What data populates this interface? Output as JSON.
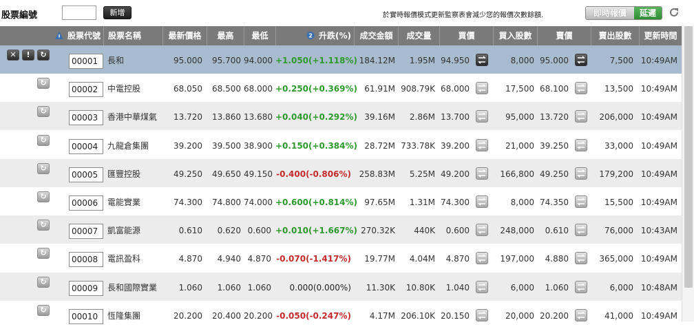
{
  "toolbar": {
    "label": "股票編號",
    "input_value": "",
    "add_label": "新增",
    "notice": "於實時報價模式更新監察表會減少您的報價次數餘額.",
    "mode_realtime": "即時報價",
    "mode_delayed": "延遲"
  },
  "columns": [
    "股票代號",
    "股票名稱",
    "最新價格",
    "最高",
    "最低",
    "升跌(%)",
    "成交金額",
    "成交量",
    "買價",
    "買入股數",
    "賣價",
    "賣出股數",
    "更新時間"
  ],
  "colors": {
    "up": "#2e9a2e",
    "down": "#c42b2b",
    "header": "#7a7a7a",
    "selected": "#a9bccf"
  },
  "rows": [
    {
      "code": "00001",
      "name": "長和",
      "last": "95.000",
      "high": "95.700",
      "low": "94.000",
      "change": "+1.050(+1.118%)",
      "dir": "up",
      "turnover": "184.12M",
      "volume": "1.95M",
      "bid": "94.950",
      "bid_qty": "8,000",
      "ask": "95.000",
      "ask_qty": "7,500",
      "time": "10:49AM"
    },
    {
      "code": "00002",
      "name": "中電控股",
      "last": "68.050",
      "high": "68.500",
      "low": "68.000",
      "change": "+0.250(+0.369%)",
      "dir": "up",
      "turnover": "61.91M",
      "volume": "908.79K",
      "bid": "68.000",
      "bid_qty": "17,500",
      "ask": "68.100",
      "ask_qty": "13,500",
      "time": "10:49AM"
    },
    {
      "code": "00003",
      "name": "香港中華煤氣",
      "last": "13.720",
      "high": "13.860",
      "low": "13.680",
      "change": "+0.040(+0.292%)",
      "dir": "up",
      "turnover": "39.16M",
      "volume": "2.86M",
      "bid": "13.700",
      "bid_qty": "95,000",
      "ask": "13.720",
      "ask_qty": "206,000",
      "time": "10:49AM"
    },
    {
      "code": "00004",
      "name": "九龍倉集團",
      "last": "39.200",
      "high": "39.500",
      "low": "38.900",
      "change": "+0.150(+0.384%)",
      "dir": "up",
      "turnover": "28.72M",
      "volume": "733.78K",
      "bid": "39.200",
      "bid_qty": "21,000",
      "ask": "39.250",
      "ask_qty": "33,000",
      "time": "10:49AM"
    },
    {
      "code": "00005",
      "name": "匯豐控股",
      "last": "49.250",
      "high": "49.650",
      "low": "49.150",
      "change": "-0.400(-0.806%)",
      "dir": "down",
      "turnover": "258.83M",
      "volume": "5.25M",
      "bid": "49.200",
      "bid_qty": "166,800",
      "ask": "49.250",
      "ask_qty": "179,200",
      "time": "10:49AM"
    },
    {
      "code": "00006",
      "name": "電能實業",
      "last": "74.300",
      "high": "74.800",
      "low": "74.000",
      "change": "+0.600(+0.814%)",
      "dir": "up",
      "turnover": "97.65M",
      "volume": "1.31M",
      "bid": "74.300",
      "bid_qty": "8,000",
      "ask": "74.350",
      "ask_qty": "15,500",
      "time": "10:49AM"
    },
    {
      "code": "00007",
      "name": "凱富能源",
      "last": "0.610",
      "high": "0.620",
      "low": "0.600",
      "change": "+0.010(+1.667%)",
      "dir": "up",
      "turnover": "270.32K",
      "volume": "440K",
      "bid": "0.600",
      "bid_qty": "248,000",
      "ask": "0.610",
      "ask_qty": "76,000",
      "time": "10:43AM"
    },
    {
      "code": "00008",
      "name": "電訊盈科",
      "last": "4.870",
      "high": "4.940",
      "low": "4.870",
      "change": "-0.070(-1.417%)",
      "dir": "down",
      "turnover": "19.77M",
      "volume": "4.04M",
      "bid": "4.870",
      "bid_qty": "197,000",
      "ask": "4.880",
      "ask_qty": "365,000",
      "time": "10:49AM"
    },
    {
      "code": "00009",
      "name": "長和國際實業",
      "last": "1.060",
      "high": "1.060",
      "low": "1.060",
      "change": "0.000(0.000%)",
      "dir": "flat",
      "turnover": "11.30K",
      "volume": "10.80K",
      "bid": "1.040",
      "bid_qty": "6,000",
      "ask": "1.060",
      "ask_qty": "6,000",
      "time": "10:48AM"
    },
    {
      "code": "00010",
      "name": "恆隆集團",
      "last": "20.200",
      "high": "20.400",
      "low": "20.200",
      "change": "-0.050(-0.247%)",
      "dir": "down",
      "turnover": "4.17M",
      "volume": "206.10K",
      "bid": "20.150",
      "bid_qty": "20,000",
      "ask": "20.200",
      "ask_qty": "41,000",
      "time": "10:49AM"
    }
  ]
}
